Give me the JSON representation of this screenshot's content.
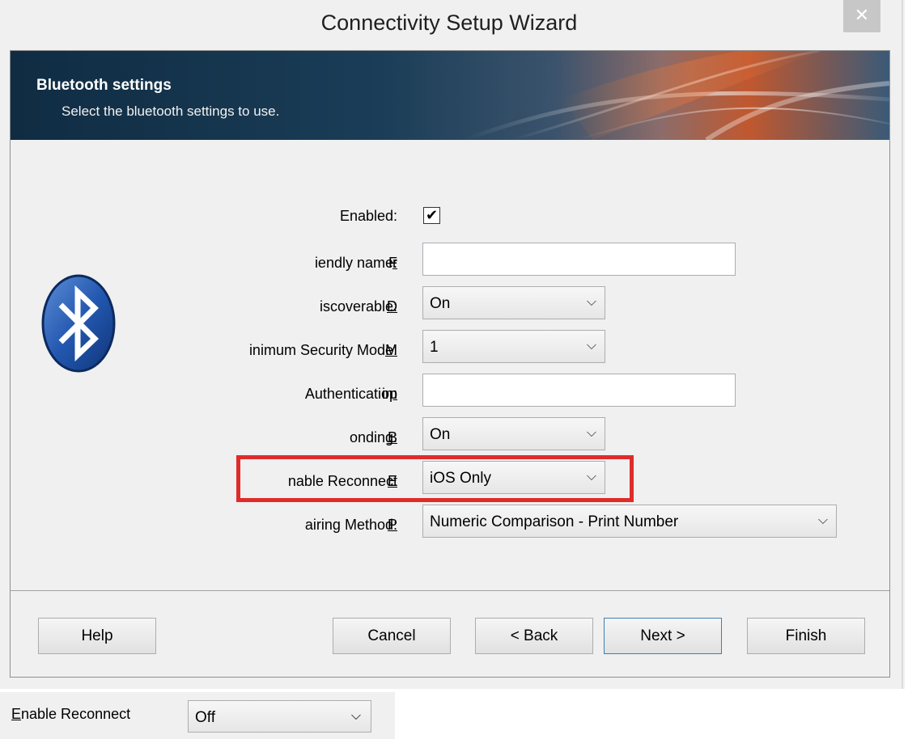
{
  "window": {
    "title": "Connectivity Setup Wizard",
    "close_glyph": "✕"
  },
  "banner": {
    "title": "Bluetooth settings",
    "subtitle": "Select the bluetooth settings to use."
  },
  "icons": {
    "bluetooth": "bluetooth-icon",
    "chevron": "chevron-down-icon",
    "check": "checkmark-icon"
  },
  "form": {
    "enabled": {
      "label": "Enabled:",
      "checked": true,
      "check_glyph": "✔"
    },
    "friendly_name": {
      "label_pre": "F",
      "label_u": "r",
      "label_post": "iendly name:",
      "value": ""
    },
    "discoverable": {
      "label_u": "D",
      "label_post": "iscoverable:",
      "value": "On"
    },
    "min_security": {
      "label_u": "M",
      "label_post": "inimum Security Mode:",
      "value": "1"
    },
    "auth_pin": {
      "label_pre": "Authentication ",
      "label_u": "p",
      "label_post": "in:",
      "value": ""
    },
    "bonding": {
      "label_u": "B",
      "label_post": "onding:",
      "value": "On"
    },
    "enable_reconnect": {
      "label_u": "E",
      "label_post": "nable Reconnect",
      "value": "iOS Only"
    },
    "pairing_method": {
      "label_u": "P",
      "label_post": "airing Method:",
      "value": "Numeric Comparison - Print Number"
    }
  },
  "buttons": {
    "help": "Help",
    "cancel": "Cancel",
    "back": "< Back",
    "next": "Next >",
    "finish": "Finish"
  },
  "chevron_glyph": "⌄",
  "inset": {
    "label_u": "E",
    "label_post": "nable Reconnect",
    "value": "Off"
  },
  "colors": {
    "highlight": "#e02b2b",
    "bluetooth_blue": "#2358b0",
    "banner_dark": "#0f2c43"
  }
}
